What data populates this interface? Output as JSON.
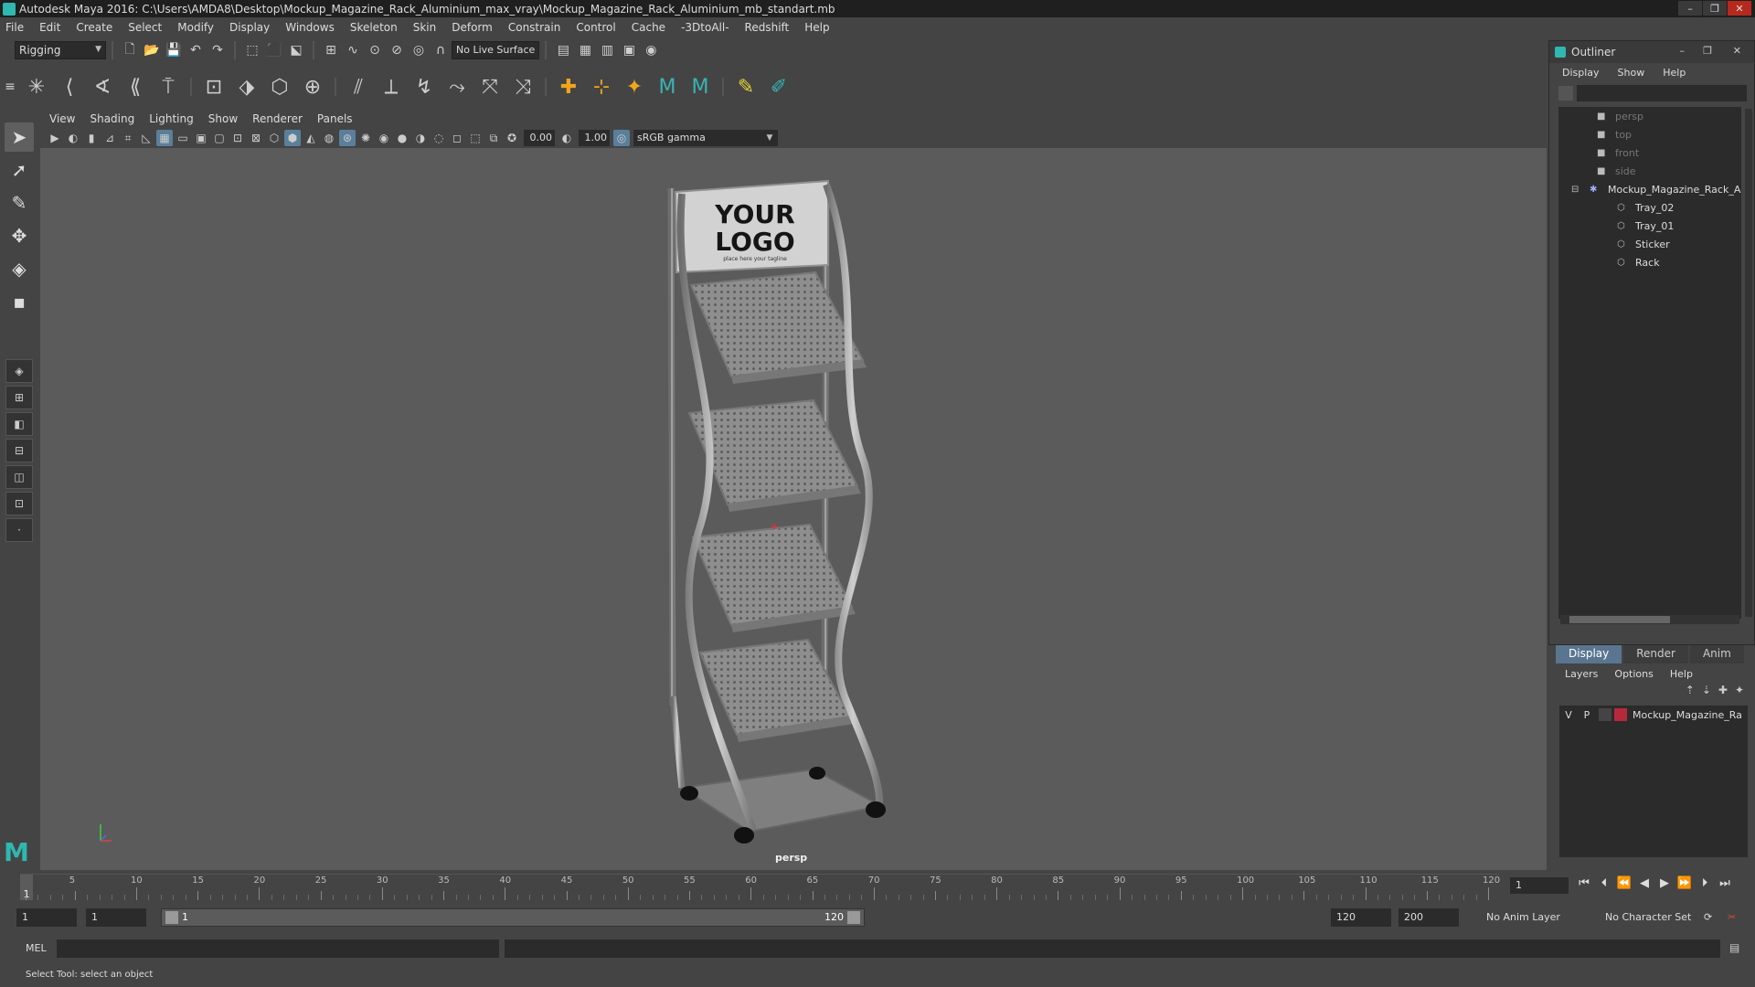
{
  "window": {
    "title": "Autodesk Maya 2016: C:\\Users\\AMDA8\\Desktop\\Mockup_Magazine_Rack_Aluminium_max_vray\\Mockup_Magazine_Rack_Aluminium_mb_standart.mb",
    "minimize": "–",
    "maximize": "❐",
    "close": "✕"
  },
  "menubar": [
    "File",
    "Edit",
    "Create",
    "Select",
    "Modify",
    "Display",
    "Windows",
    "Skeleton",
    "Skin",
    "Deform",
    "Constrain",
    "Control",
    "Cache",
    "-3DtoAll-",
    "Redshift",
    "Help"
  ],
  "status_line": {
    "mode": "Rigging",
    "live_surface": "No Live Surface"
  },
  "viewport": {
    "menu": [
      "View",
      "Shading",
      "Lighting",
      "Show",
      "Renderer",
      "Panels"
    ],
    "exposure": "0.00",
    "gamma": "1.00",
    "color_space": "sRGB gamma",
    "camera_label": "persp",
    "rack_logo_line1": "YOUR",
    "rack_logo_line2": "LOGO",
    "rack_tagline": "place here your tagline"
  },
  "outliner": {
    "title": "Outliner",
    "menu": [
      "Display",
      "Show",
      "Help"
    ],
    "cameras": [
      "persp",
      "top",
      "front",
      "side"
    ],
    "group": "Mockup_Magazine_Rack_A",
    "children": [
      "Tray_02",
      "Tray_01",
      "Sticker",
      "Rack"
    ]
  },
  "layer_editor": {
    "tabs": [
      "Display",
      "Render",
      "Anim"
    ],
    "menu": [
      "Layers",
      "Options",
      "Help"
    ],
    "layer": {
      "v": "V",
      "p": "P",
      "name": "Mockup_Magazine_Ra",
      "color": "#b52a3a"
    }
  },
  "time_slider": {
    "ticks": [
      1,
      5,
      10,
      15,
      20,
      25,
      30,
      35,
      40,
      45,
      50,
      55,
      60,
      65,
      70,
      75,
      80,
      85,
      90,
      95,
      100,
      105,
      110,
      115,
      120
    ],
    "min": 1,
    "max": 120,
    "current": "1",
    "current_frame_field": "1"
  },
  "range_slider": {
    "start": "1",
    "playback_start": "1",
    "range_low": "1",
    "range_high": "120",
    "playback_end": "120",
    "end": "200",
    "anim_layer": "No Anim Layer",
    "character_set": "No Character Set"
  },
  "command_line": {
    "label": "MEL"
  },
  "help_line": "Select Tool: select an object",
  "colors": {
    "accent": "#2fb7b0",
    "selection": "#5a7590",
    "close": "#b52a1c"
  }
}
